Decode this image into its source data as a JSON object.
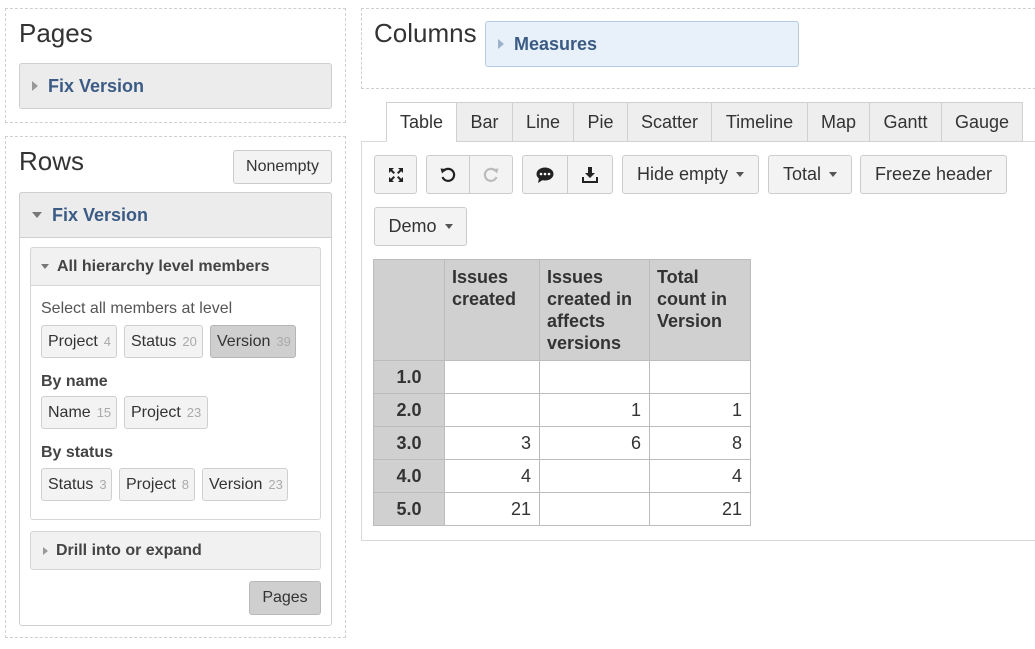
{
  "pages": {
    "title": "Pages",
    "dimension": "Fix Version"
  },
  "rows": {
    "title": "Rows",
    "nonempty_label": "Nonempty",
    "dimension": "Fix Version",
    "hierarchy_label": "All hierarchy level members",
    "select_level_label": "Select all members at level",
    "level_chips": [
      {
        "label": "Project",
        "count": "4"
      },
      {
        "label": "Status",
        "count": "20"
      },
      {
        "label": "Version",
        "count": "39"
      }
    ],
    "by_name_label": "By name",
    "name_chips": [
      {
        "label": "Name",
        "count": "15"
      },
      {
        "label": "Project",
        "count": "23"
      }
    ],
    "by_status_label": "By status",
    "status_chips": [
      {
        "label": "Status",
        "count": "3"
      },
      {
        "label": "Project",
        "count": "8"
      },
      {
        "label": "Version",
        "count": "23"
      }
    ],
    "drill_label": "Drill into or expand",
    "pages_button": "Pages"
  },
  "columns": {
    "title": "Columns",
    "dimension": "Measures"
  },
  "tabs": [
    "Table",
    "Bar",
    "Line",
    "Pie",
    "Scatter",
    "Timeline",
    "Map",
    "Gantt",
    "Gauge"
  ],
  "toolbar": {
    "hide_empty": "Hide empty",
    "total": "Total",
    "freeze_header": "Freeze header",
    "demo": "Demo"
  },
  "table": {
    "headers": [
      "Issues created",
      "Issues created in affects versions",
      "Total count in Version"
    ],
    "rows": [
      {
        "label": "1.0",
        "values": [
          "",
          "",
          ""
        ]
      },
      {
        "label": "2.0",
        "values": [
          "",
          "1",
          "1"
        ]
      },
      {
        "label": "3.0",
        "values": [
          "3",
          "6",
          "8"
        ]
      },
      {
        "label": "4.0",
        "values": [
          "4",
          "",
          "4"
        ]
      },
      {
        "label": "5.0",
        "values": [
          "21",
          "",
          "21"
        ]
      }
    ]
  }
}
